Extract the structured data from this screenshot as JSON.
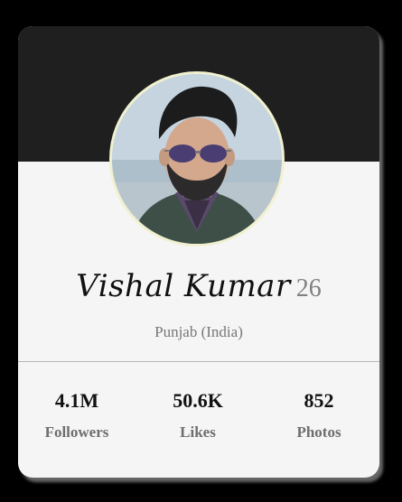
{
  "profile": {
    "name": "Vishal Kumar",
    "age": "26",
    "location": "Punjab (India)"
  },
  "stats": [
    {
      "value": "4.1M",
      "label": "Followers"
    },
    {
      "value": "50.6K",
      "label": "Likes"
    },
    {
      "value": "852",
      "label": "Photos"
    }
  ],
  "colors": {
    "page_background": "#000000",
    "banner": "#1f1f1f",
    "card": "#f5f5f5",
    "avatar_ring": "#f1f0cf",
    "label_gray": "#6e6e6e"
  },
  "icons": {
    "avatar": "profile-photo"
  }
}
